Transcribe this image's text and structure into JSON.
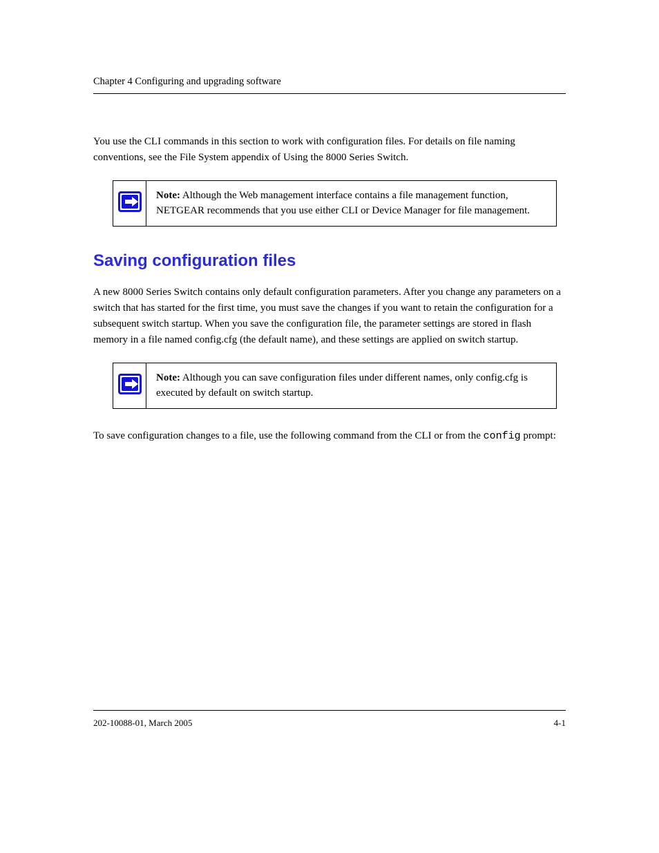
{
  "header": {
    "running": "Chapter 4 Configuring and upgrading software"
  },
  "paragraphs": {
    "p1": "You use the CLI commands in this section to work with configuration files. For details on file naming conventions, see the File System appendix of Using the 8000 Series Switch.",
    "note1_label": "Note:",
    "note1_text": " Although the Web management interface contains a file management function, NETGEAR recommends that you use either CLI or Device Manager for file management.",
    "subtitle": "Saving configuration files",
    "p2": "A new 8000 Series Switch contains only default configuration parameters. After you change any parameters on a switch that has started for the first time, you must save the changes if you want to retain the configuration for a subsequent switch startup. When you save the configuration file, the parameter settings are stored in flash memory in a file named config.cfg (the default name), and these settings are applied on switch startup.",
    "note2_label": "Note:",
    "note2_text": " Although you can save configuration files under different names, only config.cfg is executed by default on switch startup.",
    "p3_a": "To save configuration changes to a file, use the following command from the CLI or from the ",
    "p3_code": "config",
    "p3_b": " prompt:"
  },
  "footer": {
    "left": "202-10088-01, March 2005",
    "right": "4-1"
  }
}
